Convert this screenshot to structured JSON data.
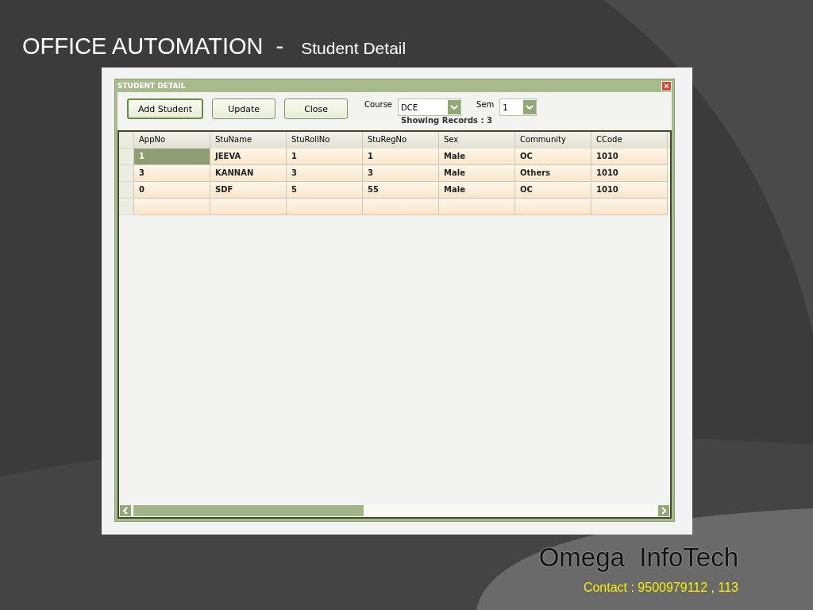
{
  "slide": {
    "title": "OFFICE AUTOMATION  -",
    "subtitle": "Student Detail",
    "brand": "Omega  InfoTech",
    "contact": "Contact : 9500979112 , 113"
  },
  "window": {
    "title": "STUDENT DETAIL",
    "close": "×"
  },
  "buttons": [
    {
      "label": "Add Student",
      "focused": true
    },
    {
      "label": "Update",
      "focused": false
    },
    {
      "label": "Close",
      "focused": false
    }
  ],
  "filters": [
    {
      "label": "Course",
      "value": "DCE"
    },
    {
      "label": "Sem",
      "value": "1"
    }
  ],
  "status": "Showing Records : 3",
  "table": {
    "columns": [
      "AppNo",
      "StuName",
      "StuRollNo",
      "StuRegNo",
      "Sex",
      "Community",
      "CCode"
    ],
    "rows": [
      {
        "cells": [
          {
            "text": "1",
            "selected": true
          },
          {
            "text": "JEEVA",
            "selected": false
          },
          {
            "text": "1",
            "selected": false
          },
          {
            "text": "1",
            "selected": false
          },
          {
            "text": "Male",
            "selected": false
          },
          {
            "text": "OC",
            "selected": false
          },
          {
            "text": "1010",
            "selected": false
          }
        ]
      },
      {
        "cells": [
          {
            "text": "3",
            "selected": false
          },
          {
            "text": "KANNAN",
            "selected": false
          },
          {
            "text": "3",
            "selected": false
          },
          {
            "text": "3",
            "selected": false
          },
          {
            "text": "Male",
            "selected": false
          },
          {
            "text": "Others",
            "selected": false
          },
          {
            "text": "1010",
            "selected": false
          }
        ]
      },
      {
        "cells": [
          {
            "text": "0",
            "selected": false
          },
          {
            "text": "SDF",
            "selected": false
          },
          {
            "text": "5",
            "selected": false
          },
          {
            "text": "55",
            "selected": false
          },
          {
            "text": "Male",
            "selected": false
          },
          {
            "text": "OC",
            "selected": false
          },
          {
            "text": "1010",
            "selected": false
          }
        ]
      }
    ]
  }
}
